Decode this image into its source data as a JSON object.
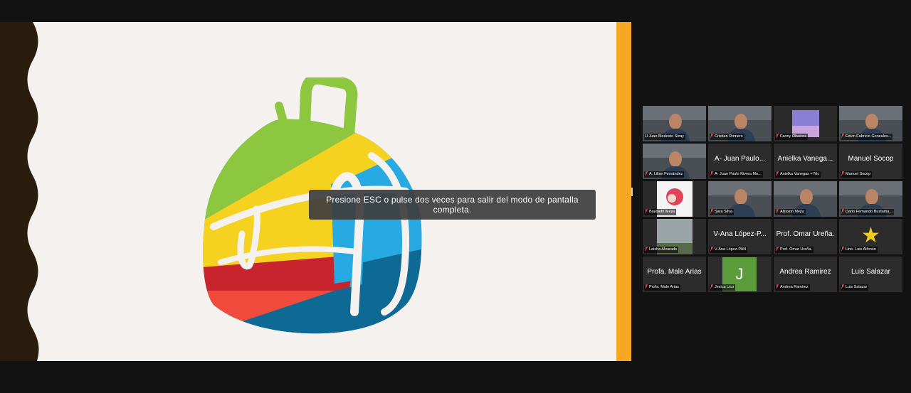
{
  "fullscreen_notice": "Presione ESC o pulse dos veces para salir del modo de pantalla completa.",
  "colors": {
    "background": "#121212",
    "slide_background": "#f4f1ee",
    "slide_wave": "#2b1d0e",
    "slide_stripe": "#f7a823",
    "tile_background": "#2c2c2c",
    "active_speaker_border": "#c6e24b",
    "muted_icon": "#e0443d",
    "backpack_green": "#8dc63f",
    "backpack_yellow": "#f4d21f",
    "backpack_red": "#c8242e",
    "backpack_orange_red": "#ef4a3c",
    "backpack_blue": "#27aae1",
    "backpack_dark_blue": "#0e6a94"
  },
  "participants": [
    {
      "name": "H Juan Modesto Sicay",
      "display": "",
      "type": "video",
      "icon": "person-video",
      "active": true,
      "muted": false
    },
    {
      "name": "Cristian Romero",
      "display": "",
      "type": "video",
      "icon": "person-video",
      "active": false,
      "muted": true
    },
    {
      "name": "Fanny Oliveros",
      "display": "",
      "type": "video",
      "icon": "picture-video",
      "active": false,
      "muted": true
    },
    {
      "name": "Edvin Fabricio Gonzales...",
      "display": "",
      "type": "video",
      "icon": "person-video",
      "active": false,
      "muted": true
    },
    {
      "name": "A. Lilian Fernández",
      "display": "",
      "type": "video",
      "icon": "person-video",
      "active": false,
      "muted": true
    },
    {
      "name": "A- Juan Paulo Rivera Mo...",
      "display": "A- Juan Paulo...",
      "type": "name",
      "icon": "",
      "active": false,
      "muted": true
    },
    {
      "name": "Anielka Vanegas + Nic",
      "display": "Anielka Vanega...",
      "type": "name",
      "icon": "",
      "active": false,
      "muted": true
    },
    {
      "name": "Manuel Socop",
      "display": "Manuel Socop",
      "type": "name",
      "icon": "",
      "active": false,
      "muted": true
    },
    {
      "name": "Bayoleth Mejía",
      "display": "",
      "type": "video",
      "icon": "drawing-video",
      "active": false,
      "muted": true
    },
    {
      "name": "Sara Silva",
      "display": "",
      "type": "video",
      "icon": "person-video",
      "active": false,
      "muted": true
    },
    {
      "name": "Allisson Mejía",
      "display": "",
      "type": "video",
      "icon": "person-video",
      "active": false,
      "muted": true
    },
    {
      "name": "Dario Fernando Bustama...",
      "display": "",
      "type": "video",
      "icon": "person-video",
      "active": false,
      "muted": true
    },
    {
      "name": "Laisha Alvarado",
      "display": "",
      "type": "video",
      "icon": "landscape-video",
      "active": false,
      "muted": true
    },
    {
      "name": "V-Ana López-PAN",
      "display": "V-Ana López-P...",
      "type": "name",
      "icon": "",
      "active": false,
      "muted": true
    },
    {
      "name": "Prof. Omar Ureña.",
      "display": "Prof. Omar Ureña.",
      "type": "name",
      "icon": "",
      "active": false,
      "muted": true
    },
    {
      "name": "Hno. Luis Alfonso",
      "display": "★",
      "type": "star",
      "icon": "star",
      "active": false,
      "muted": true
    },
    {
      "name": "Profa. Male Arias",
      "display": "Profa. Male Arias",
      "type": "name",
      "icon": "",
      "active": false,
      "muted": true
    },
    {
      "name": "Jesica Lico",
      "display": "J",
      "type": "avatar",
      "icon": "",
      "active": false,
      "muted": true
    },
    {
      "name": "Andrea Ramirez",
      "display": "Andrea Ramirez",
      "type": "name",
      "icon": "",
      "active": false,
      "muted": true
    },
    {
      "name": "Luis Salazar",
      "display": "Luis Salazar",
      "type": "name",
      "icon": "",
      "active": false,
      "muted": true
    }
  ]
}
